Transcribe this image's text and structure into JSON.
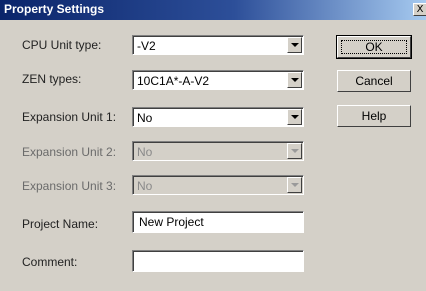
{
  "window": {
    "title": "Property Settings",
    "close_glyph": "X"
  },
  "form": {
    "cpu_unit_type": {
      "label": "CPU Unit type:",
      "value": "-V2"
    },
    "zen_types": {
      "label": "ZEN types:",
      "value": "10C1A*-A-V2"
    },
    "expansion_unit_1": {
      "label": "Expansion Unit 1:",
      "value": "No"
    },
    "expansion_unit_2": {
      "label": "Expansion Unit 2:",
      "value": "No"
    },
    "expansion_unit_3": {
      "label": "Expansion Unit 3:",
      "value": "No"
    },
    "project_name": {
      "label": "Project Name:",
      "value": "New Project"
    },
    "comment": {
      "label": "Comment:",
      "value": ""
    }
  },
  "buttons": {
    "ok": "OK",
    "cancel": "Cancel",
    "help": "Help"
  },
  "colors": {
    "title_bar": "#0a246a",
    "dialog_face": "#d4d0c8"
  }
}
